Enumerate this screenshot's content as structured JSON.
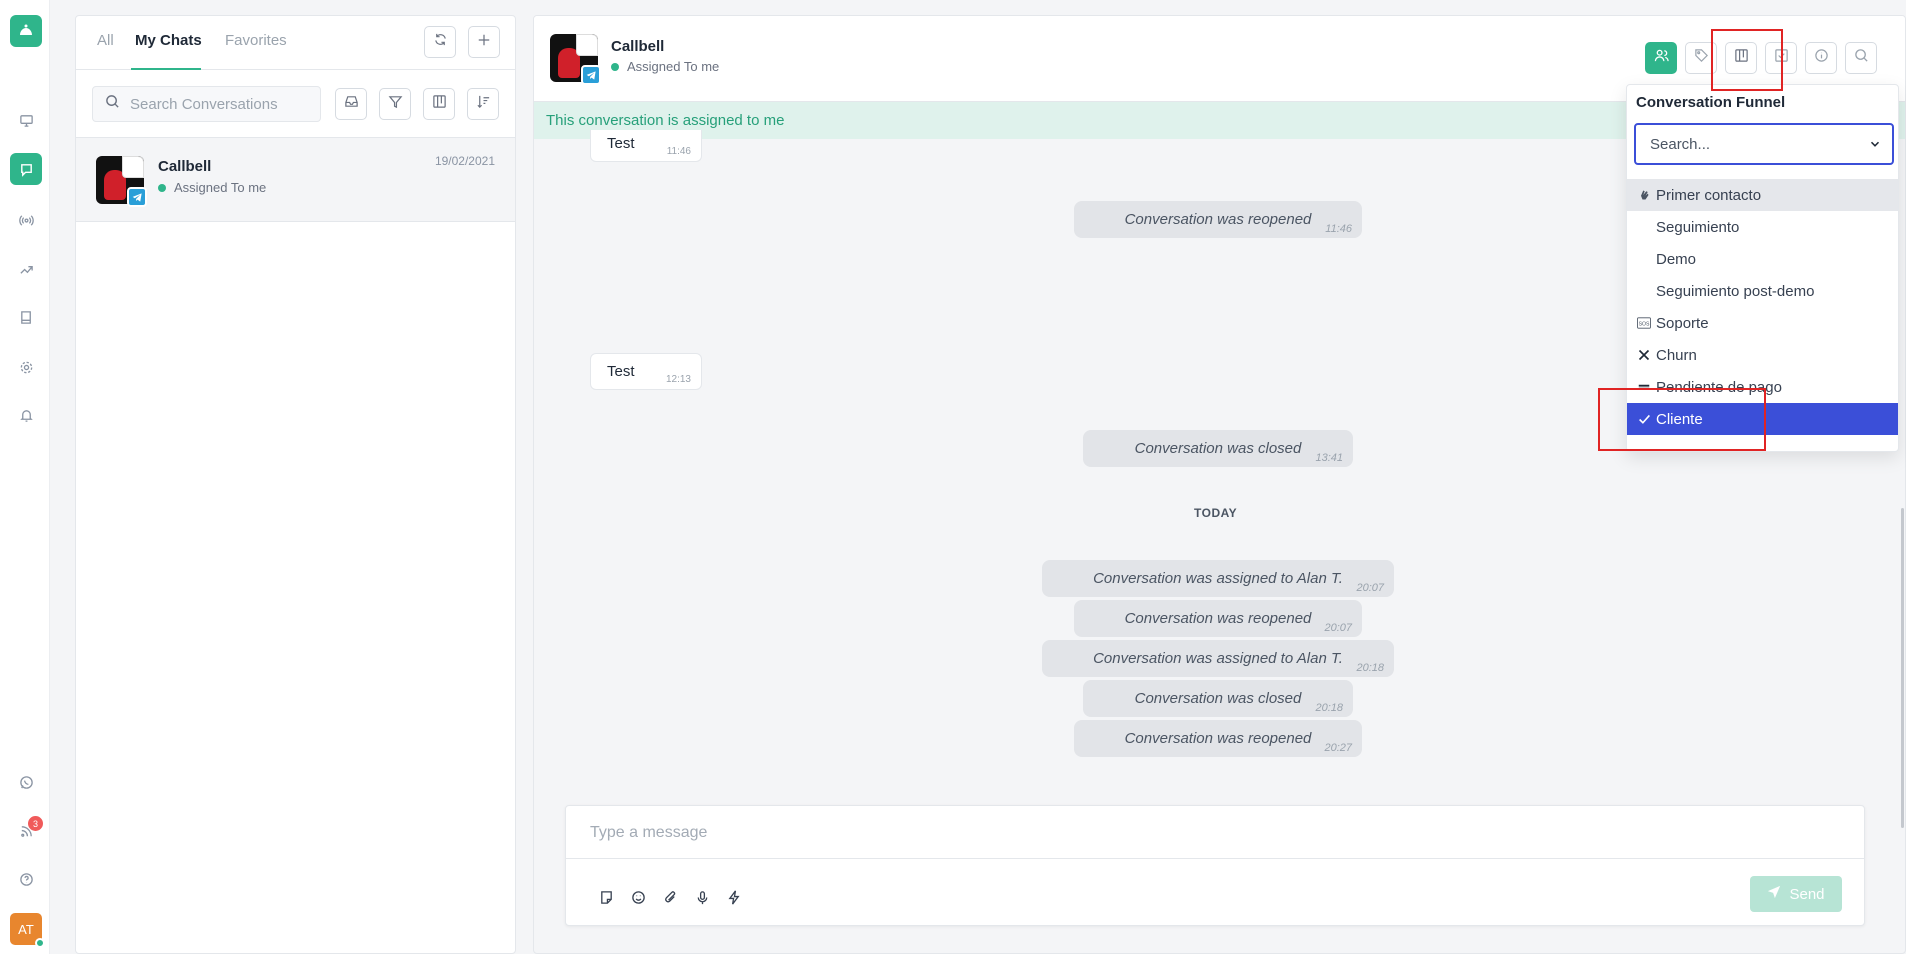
{
  "rail": {
    "badge_count": "3",
    "avatar_initials": "AT",
    "icons": [
      "bell-logo-icon",
      "monitor-icon",
      "chat-icon",
      "broadcast-icon",
      "trend-icon",
      "book-icon",
      "gear-icon",
      "bell-icon",
      "whatsapp-icon",
      "rss-icon",
      "help-icon"
    ]
  },
  "list": {
    "tabs": [
      "All",
      "My Chats",
      "Favorites"
    ],
    "active_tab": "My Chats",
    "search_placeholder": "Search Conversations",
    "items": [
      {
        "name": "Callbell",
        "status": "Assigned To me",
        "date": "19/02/2021"
      }
    ]
  },
  "chat": {
    "name": "Callbell",
    "status": "Assigned To me",
    "assigned_banner": "This conversation is assigned to me",
    "messages": [
      {
        "kind": "in",
        "text": "Test",
        "time": "11:46"
      },
      {
        "kind": "system",
        "text": "Conversation was reopened",
        "time": "11:46"
      },
      {
        "kind": "in",
        "text": "Test",
        "time": "12:13"
      },
      {
        "kind": "system",
        "text": "Conversation was closed",
        "time": "13:41"
      },
      {
        "kind": "system",
        "text": "Conversation was assigned to Alan T.",
        "time": "20:07"
      },
      {
        "kind": "system",
        "text": "Conversation was reopened",
        "time": "20:07"
      },
      {
        "kind": "system",
        "text": "Conversation was assigned to Alan T.",
        "time": "20:18"
      },
      {
        "kind": "system",
        "text": "Conversation was closed",
        "time": "20:18"
      },
      {
        "kind": "system",
        "text": "Conversation was reopened",
        "time": "20:27"
      }
    ],
    "date_divider": "TODAY",
    "composer_placeholder": "Type a message",
    "send_label": "Send"
  },
  "funnel": {
    "title": "Conversation Funnel",
    "search_placeholder": "Search...",
    "options": [
      {
        "icon": "wave-hand-icon",
        "label": "Primer contacto",
        "state": "hover"
      },
      {
        "icon": "",
        "label": "Seguimiento",
        "state": ""
      },
      {
        "icon": "",
        "label": "Demo",
        "state": ""
      },
      {
        "icon": "",
        "label": "Seguimiento post-demo",
        "state": ""
      },
      {
        "icon": "sos-icon",
        "label": "Soporte",
        "state": ""
      },
      {
        "icon": "cross-icon",
        "label": "Churn",
        "state": ""
      },
      {
        "icon": "bars-icon",
        "label": "Pendiente de pago",
        "state": ""
      },
      {
        "icon": "check-icon",
        "label": "Cliente",
        "state": "selected"
      }
    ]
  },
  "colors": {
    "accent": "#2fb58b",
    "selection": "#3b4fd8",
    "highlight_box": "#e02424",
    "banner_bg": "#dff2ec"
  }
}
